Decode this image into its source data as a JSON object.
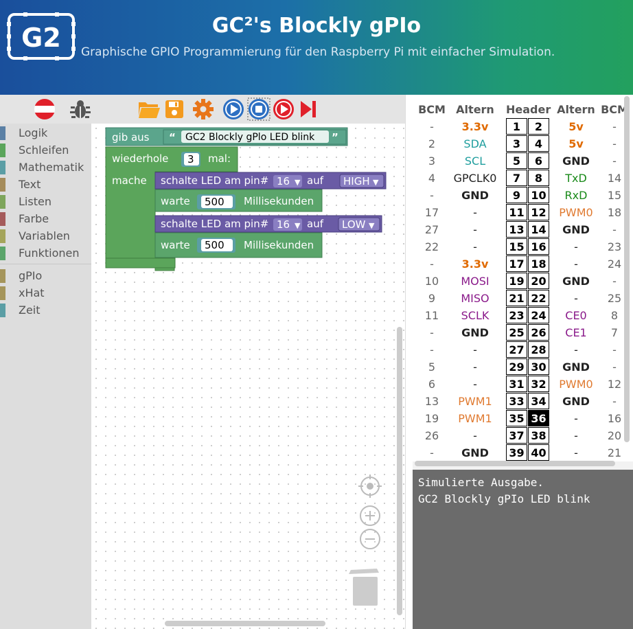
{
  "header": {
    "title": "GC²'s Blockly gPIo",
    "subtitle": "Graphische GPIO Programmierung für den Raspberry Pi mit einfacher Simulation.",
    "logo_text": "G2"
  },
  "toolbar": {
    "language_icon": "austria-flag-icon",
    "debug_icon": "bug-icon",
    "open_icon": "folder-open-icon",
    "save_icon": "save-icon",
    "settings_icon": "gear-icon",
    "run_icon": "play-icon",
    "stop_icon": "stop-icon",
    "run_sim_icon": "play-red-icon",
    "step_icon": "step-icon"
  },
  "toolbox": {
    "categories": [
      {
        "label": "Logik",
        "color": "#5b80a5"
      },
      {
        "label": "Schleifen",
        "color": "#5ba55b"
      },
      {
        "label": "Mathematik",
        "color": "#5b9ea5"
      },
      {
        "label": "Text",
        "color": "#a58c5b"
      },
      {
        "label": "Listen",
        "color": "#7ea55b"
      },
      {
        "label": "Farbe",
        "color": "#a55b5b"
      },
      {
        "label": "Variablen",
        "color": "#a5a55b"
      },
      {
        "label": "Funktionen",
        "color": "#5ba56b"
      }
    ],
    "extra": [
      {
        "label": "gPIo",
        "color": "#a5955b"
      },
      {
        "label": "xHat",
        "color": "#a5955b"
      },
      {
        "label": "Zeit",
        "color": "#5b9ea5"
      }
    ]
  },
  "blocks": {
    "print_label": "gib aus",
    "print_text": "GC2 Blockly gPlo LED blink",
    "repeat_label": "wiederhole",
    "repeat_count": "3",
    "repeat_suffix": "mal:",
    "do_label": "mache",
    "led1_label": "schalte LED am pin#",
    "led1_pin": "16",
    "led1_on": "auf",
    "led1_state": "HIGH",
    "wait1_label": "warte",
    "wait1_value": "500",
    "wait1_unit": "Millisekunden",
    "led2_label": "schalte LED am pin#",
    "led2_pin": "16",
    "led2_on": "auf",
    "led2_state": "LOW",
    "wait2_label": "warte",
    "wait2_value": "500",
    "wait2_unit": "Millisekunden",
    "quote_open": "“",
    "quote_close": "”"
  },
  "pins": {
    "headers": [
      "BCM",
      "Altern",
      "Header",
      "Altern",
      "BCM"
    ],
    "rows": [
      [
        "-",
        "3.3v",
        "1",
        "2",
        "5v",
        "-"
      ],
      [
        "2",
        "SDA",
        "3",
        "4",
        "5v",
        "-"
      ],
      [
        "3",
        "SCL",
        "5",
        "6",
        "GND",
        "-"
      ],
      [
        "4",
        "GPCLK0",
        "7",
        "8",
        "TxD",
        "14"
      ],
      [
        "-",
        "GND",
        "9",
        "10",
        "RxD",
        "15"
      ],
      [
        "17",
        "-",
        "11",
        "12",
        "PWM0",
        "18"
      ],
      [
        "27",
        "-",
        "13",
        "14",
        "GND",
        "-"
      ],
      [
        "22",
        "-",
        "15",
        "16",
        "-",
        "23"
      ],
      [
        "-",
        "3.3v",
        "17",
        "18",
        "-",
        "24"
      ],
      [
        "10",
        "MOSI",
        "19",
        "20",
        "GND",
        "-"
      ],
      [
        "9",
        "MISO",
        "21",
        "22",
        "-",
        "25"
      ],
      [
        "11",
        "SCLK",
        "23",
        "24",
        "CE0",
        "8"
      ],
      [
        "-",
        "GND",
        "25",
        "26",
        "CE1",
        "7"
      ],
      [
        "-",
        "-",
        "27",
        "28",
        "-",
        "-"
      ],
      [
        "5",
        "-",
        "29",
        "30",
        "GND",
        "-"
      ],
      [
        "6",
        "-",
        "31",
        "32",
        "PWM0",
        "12"
      ],
      [
        "13",
        "PWM1",
        "33",
        "34",
        "GND",
        "-"
      ],
      [
        "19",
        "PWM1",
        "35",
        "36",
        "-",
        "16"
      ],
      [
        "26",
        "-",
        "37",
        "38",
        "-",
        "20"
      ],
      [
        "-",
        "GND",
        "39",
        "40",
        "-",
        "21"
      ]
    ],
    "active_pin": "36",
    "colors": {
      "power": "#e06a00",
      "i2c": "#1f9e9e",
      "spi": "#8a1a8a",
      "uart": "#1a8a1a",
      "pwm": "#e07a30",
      "plain": "#222222",
      "bcm": "#666666"
    }
  },
  "console": {
    "lines": [
      "Simulierte Ausgabe.",
      "GC2 Blockly gPIo LED blink"
    ]
  },
  "workspace_controls": {
    "center_icon": "target-icon",
    "zoom_in_icon": "zoom-in-icon",
    "zoom_out_icon": "zoom-out-icon",
    "trash_icon": "trash-icon"
  }
}
